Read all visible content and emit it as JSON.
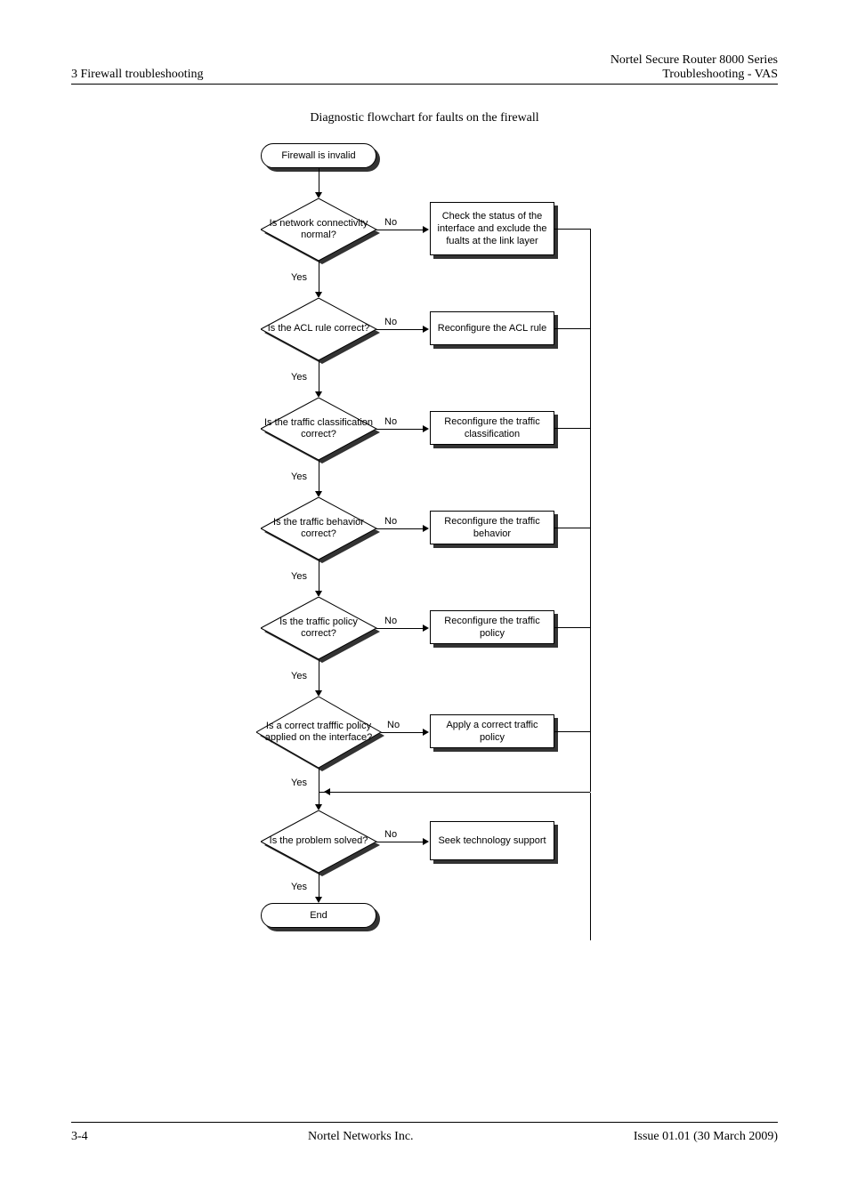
{
  "header": {
    "left": "3 Firewall troubleshooting",
    "right_line1": "Nortel Secure Router 8000 Series",
    "right_line2": "Troubleshooting - VAS"
  },
  "caption": "Diagnostic flowchart for faults on the firewall",
  "flow": {
    "start": "Firewall is invalid",
    "d1": "Is network connectivity normal?",
    "a1": "Check the status of the interface and exclude the fualts at the link layer",
    "d2": "Is the ACL rule correct?",
    "a2": "Reconfigure the ACL rule",
    "d3": "Is the traffic classification correct?",
    "a3": "Reconfigure the traffic classification",
    "d4": "Is the traffic behavior correct?",
    "a4": "Reconfigure the traffic behavior",
    "d5": "Is the traffic policy correct?",
    "a5": "Reconfigure the traffic policy",
    "d6": "Is a correct trafffic policy applied on the interface?",
    "a6": "Apply a correct traffic policy",
    "d7": "Is the problem solved?",
    "a7": "Seek technology support",
    "end": "End",
    "yes": "Yes",
    "no": "No"
  },
  "footer": {
    "page": "3-4",
    "center": "Nortel Networks Inc.",
    "right": "Issue 01.01 (30 March 2009)"
  }
}
